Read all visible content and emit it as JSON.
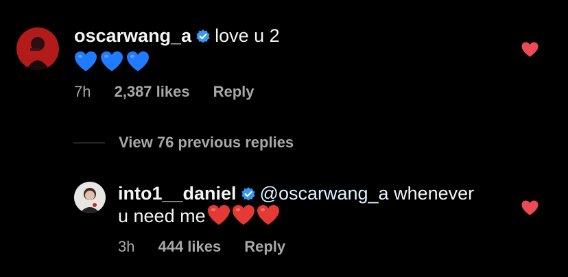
{
  "comment": {
    "username": "oscarwang_a",
    "text": "love u 2",
    "emoji_icons": [
      "blue-heart-icon",
      "blue-heart-icon",
      "blue-heart-icon"
    ],
    "time": "7h",
    "likes": "2,387 likes",
    "reply_label": "Reply"
  },
  "view_replies_label": "View 76 previous replies",
  "reply": {
    "username": "into1__daniel",
    "mention": "@oscarwang_a",
    "text_line1_rest": " whenever",
    "text_line2": "u need me",
    "emoji_icons": [
      "red-heart-icon",
      "red-heart-icon",
      "red-heart-icon"
    ],
    "time": "3h",
    "likes": "444 likes",
    "reply_label": "Reply"
  },
  "colors": {
    "background": "#000000",
    "verified_badge": "#3897f0",
    "like_heart": "#ed4956",
    "blue_heart": "#1f7bff",
    "muted_text": "#a8a8a8"
  }
}
